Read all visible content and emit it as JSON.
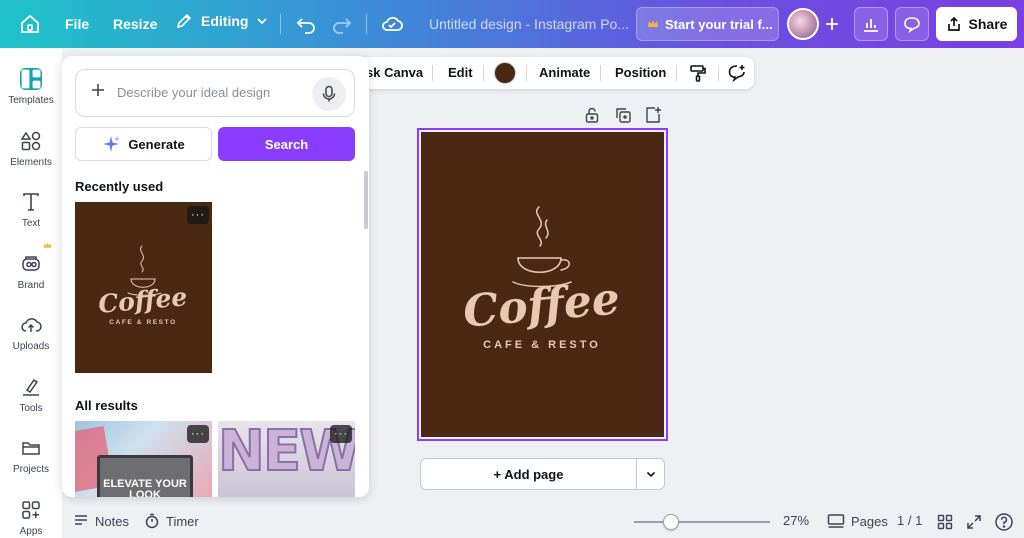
{
  "topbar": {
    "file_label": "File",
    "resize_label": "Resize",
    "editing_label": "Editing",
    "doc_title": "Untitled design - Instagram Po...",
    "trial_label": "Start your trial f...",
    "share_label": "Share"
  },
  "rail": {
    "items": [
      {
        "label": "Templates",
        "icon": "templates-icon"
      },
      {
        "label": "Elements",
        "icon": "elements-icon"
      },
      {
        "label": "Text",
        "icon": "text-icon"
      },
      {
        "label": "Brand",
        "icon": "brand-icon"
      },
      {
        "label": "Uploads",
        "icon": "uploads-icon"
      },
      {
        "label": "Tools",
        "icon": "tools-icon"
      },
      {
        "label": "Projects",
        "icon": "projects-icon"
      },
      {
        "label": "Apps",
        "icon": "apps-icon"
      }
    ]
  },
  "context_toolbar": {
    "ask_canva_label": "sk Canva",
    "edit_label": "Edit",
    "color": "#4a2914",
    "animate_label": "Animate",
    "position_label": "Position"
  },
  "panel": {
    "search_placeholder": "Describe your ideal design",
    "generate_label": "Generate",
    "search_label": "Search",
    "recently_used_title": "Recently used",
    "all_results_title": "All results",
    "more_glyph": "···"
  },
  "design": {
    "logo_text": "Coffee",
    "tagline": "CAFE & RESTO",
    "background": "#4a2914",
    "text_color": "#e8c9b0"
  },
  "results": {
    "thumb1_text": "ELEVATE YOUR LOOK",
    "thumb2_text": "NEW"
  },
  "canvas": {
    "add_page_label": "+ Add page"
  },
  "bottom": {
    "notes_label": "Notes",
    "timer_label": "Timer",
    "zoom_label": "27%",
    "zoom_fraction": 0.27,
    "pages_label": "Pages",
    "page_count": "1 / 1"
  },
  "colors": {
    "accent": "#8b3dff",
    "brand_teal": "#13a3b5"
  }
}
